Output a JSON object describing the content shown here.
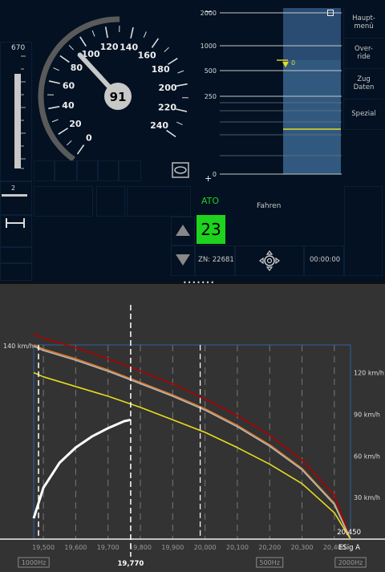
{
  "speedometer": {
    "current_speed": "91",
    "needle_speed": 91,
    "scale_labels": [
      "0",
      "20",
      "40",
      "60",
      "80",
      "100",
      "120",
      "140",
      "160",
      "180",
      "200",
      "220",
      "240"
    ],
    "max_label": "670"
  },
  "left_panel": {
    "gauge_value_label": "670",
    "distance_label": "2",
    "distance_bar_fraction": 0.16
  },
  "planning": {
    "scale_labels": [
      "2000",
      "1000",
      "500",
      "250",
      "0"
    ],
    "minus": "−",
    "plus": "+",
    "marker_value": "0",
    "square_icon": "square-icon"
  },
  "menu": {
    "items": [
      "Haupt-\nmenü",
      "Over-\nride",
      "Zug\nDaten",
      "Spezial"
    ]
  },
  "status": {
    "ato_label": "ATO",
    "mode_label": "Fahren",
    "green_value": "23",
    "train_number": "ZN: 22681",
    "clock": "00:00:00"
  },
  "colors": {
    "dmi_bg": "#031122",
    "chart_bg": "#333333",
    "ato_green": "#20d020",
    "green_box": "#1ed21e",
    "red_curve": "#b00000",
    "orange_curve": "#e07a28",
    "yellow_curve": "#e6dc1e",
    "grey_curve": "#b8b8b8",
    "blue_frame": "#2e5a8c"
  },
  "chart_data": {
    "type": "line",
    "x_ticks": [
      "19,500",
      "19,600",
      "19,700",
      "19,800",
      "19,900",
      "20,000",
      "20,100",
      "20,200",
      "20,300",
      "20,400"
    ],
    "xlim": [
      19470,
      20450
    ],
    "ylim": [
      0,
      155
    ],
    "y_tick_labels": [
      "30 km/h",
      "60 km/h",
      "90 km/h",
      "120 km/h"
    ],
    "y_tick_values": [
      30,
      60,
      90,
      120
    ],
    "left_label": "140 km/h",
    "right_end_label": "20,450",
    "marker_position_label": "19,770",
    "signal_label": "ESig A",
    "frequency_labels": [
      "1000Hz",
      "500Hz",
      "2000Hz"
    ],
    "frequency_positions": [
      19470,
      20200,
      20450
    ],
    "speed_limit_top": 140,
    "series": [
      {
        "color": "#b00000",
        "x": [
          19470,
          19500,
          19600,
          19700,
          19800,
          19900,
          20000,
          20100,
          20200,
          20300,
          20400,
          20450
        ],
        "y": [
          148,
          145,
          138,
          130,
          121,
          112,
          101,
          89,
          75,
          57,
          32,
          0
        ]
      },
      {
        "color": "#e07a28",
        "x": [
          19470,
          19500,
          19600,
          19700,
          19800,
          19900,
          20000,
          20100,
          20200,
          20300,
          20400,
          20450
        ],
        "y": [
          140,
          137,
          130,
          122,
          113,
          104,
          94,
          82,
          68,
          51,
          26,
          0
        ]
      },
      {
        "color": "#b8b8b8",
        "x": [
          19470,
          19500,
          19600,
          19700,
          19800,
          19900,
          20000,
          20100,
          20200,
          20300,
          20400,
          20450
        ],
        "y": [
          139,
          136,
          129,
          121,
          112,
          103,
          93,
          81,
          67,
          50,
          25,
          0
        ]
      },
      {
        "color": "#e6dc1e",
        "x": [
          19470,
          19500,
          19600,
          19700,
          19800,
          19900,
          20000,
          20100,
          20200,
          20300,
          20400,
          20450
        ],
        "y": [
          120,
          117,
          110,
          103,
          95,
          86,
          77,
          66,
          54,
          40,
          19,
          0
        ]
      },
      {
        "color": "#ffffff",
        "x": [
          19470,
          19500,
          19550,
          19600,
          19650,
          19700,
          19750,
          19770
        ],
        "y": [
          15,
          37,
          55,
          66,
          74,
          80,
          85,
          86
        ]
      }
    ]
  }
}
